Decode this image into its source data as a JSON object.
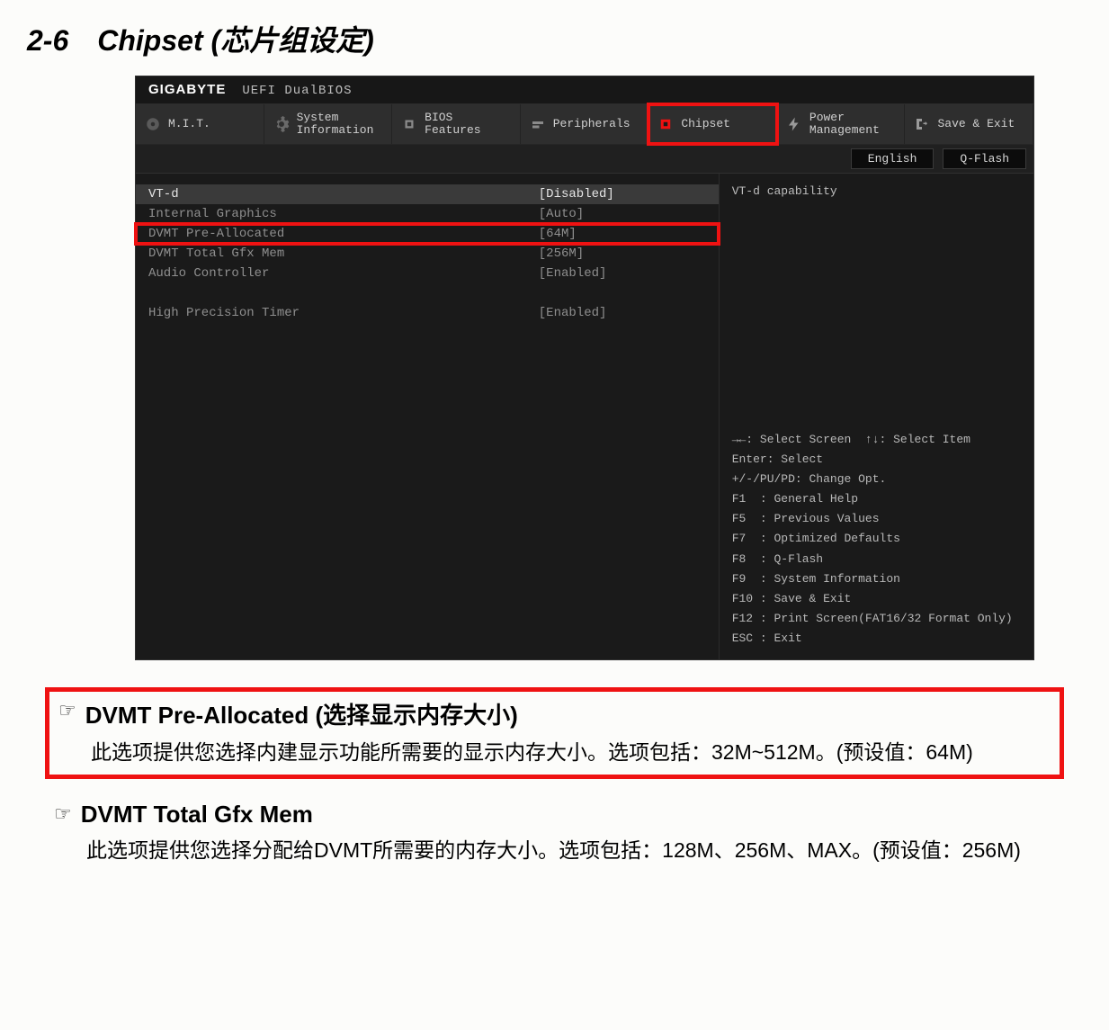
{
  "section_title": "2-6 Chipset (芯片组设定)",
  "bios": {
    "brand": "GIGABYTE",
    "subtitle": "UEFI DualBIOS",
    "tabs": [
      {
        "label": "M.I.T."
      },
      {
        "label": "System\nInformation"
      },
      {
        "label": "BIOS\nFeatures"
      },
      {
        "label": "Peripherals"
      },
      {
        "label": "Chipset"
      },
      {
        "label": "Power\nManagement"
      },
      {
        "label": "Save & Exit"
      }
    ],
    "toolbar": {
      "english": "English",
      "qflash": "Q-Flash"
    },
    "options": [
      {
        "label": "VT-d",
        "value": "[Disabled]",
        "selected": true,
        "red": false
      },
      {
        "label": "Internal Graphics",
        "value": "[Auto]",
        "selected": false,
        "red": false
      },
      {
        "label": "DVMT Pre-Allocated",
        "value": "[64M]",
        "selected": false,
        "red": true
      },
      {
        "label": "DVMT Total Gfx Mem",
        "value": "[256M]",
        "selected": false,
        "red": false
      },
      {
        "label": "Audio Controller",
        "value": "[Enabled]",
        "selected": false,
        "red": false
      }
    ],
    "options2": [
      {
        "label": "High Precision Timer",
        "value": "[Enabled]",
        "selected": false,
        "red": false
      }
    ],
    "side_info": "VT-d capability",
    "help_lines": "→←: Select Screen  ↑↓: Select Item\nEnter: Select\n+/-/PU/PD: Change Opt.\nF1  : General Help\nF5  : Previous Values\nF7  : Optimized Defaults\nF8  : Q-Flash\nF9  : System Information\nF10 : Save & Exit\nF12 : Print Screen(FAT16/32 Format Only)\nESC : Exit"
  },
  "desc": [
    {
      "title": "DVMT Pre-Allocated (选择显示内存大小)",
      "body": "此选项提供您选择内建显示功能所需要的显示内存大小。选项包括：32M~512M。(预设值：64M)",
      "red": true
    },
    {
      "title": "DVMT Total Gfx Mem",
      "body": "此选项提供您选择分配给DVMT所需要的内存大小。选项包括：128M、256M、MAX。(预设值：256M)",
      "red": false
    }
  ]
}
